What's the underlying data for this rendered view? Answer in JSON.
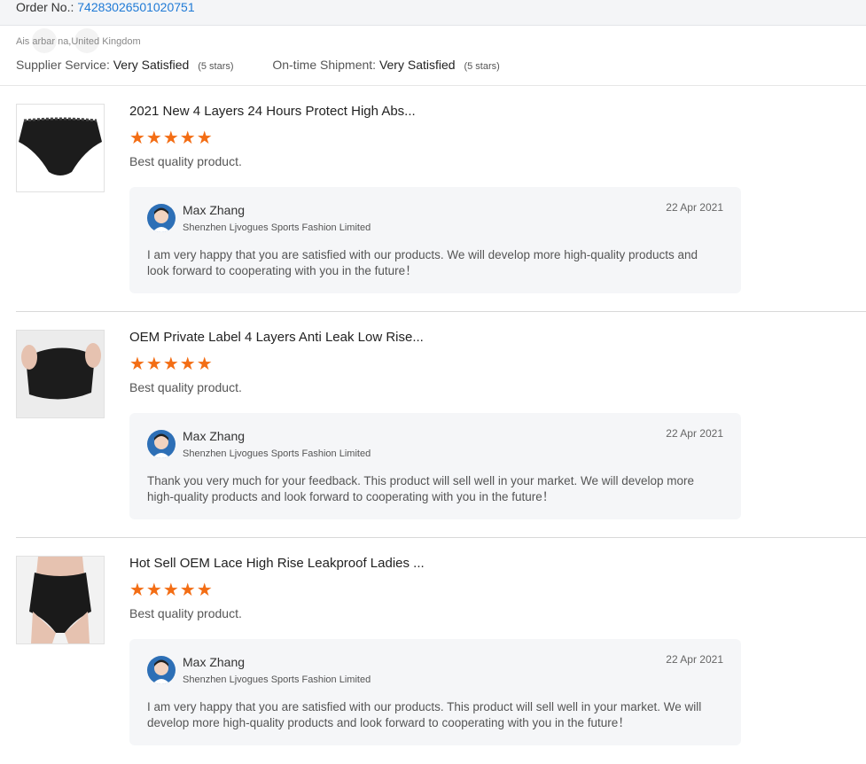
{
  "order": {
    "label": "Order No.:",
    "number": "74283026501020751"
  },
  "buyer": {
    "location": "Ais     arbar    na,United Kingdom"
  },
  "ratings": {
    "supplier_label": "Supplier Service:",
    "supplier_value": "Very Satisfied",
    "supplier_stars": "(5 stars)",
    "shipment_label": "On-time Shipment:",
    "shipment_value": "Very Satisfied",
    "shipment_stars": "(5 stars)"
  },
  "reviews": [
    {
      "title": "2021 New 4 Layers 24 Hours Protect High Abs...",
      "stars": "★★★★★",
      "rating": 5,
      "comment": "Best quality product.",
      "reply": {
        "name": "Max Zhang",
        "company": "Shenzhen Ljvogues Sports Fashion Limited",
        "date": "22 Apr 2021",
        "text": "I am very happy that you are satisfied with our products. We will develop more high-quality products and look forward to cooperating with you in the future！"
      }
    },
    {
      "title": "OEM Private Label 4 Layers Anti Leak Low Rise...",
      "stars": "★★★★★",
      "rating": 5,
      "comment": "Best quality product.",
      "reply": {
        "name": "Max Zhang",
        "company": "Shenzhen Ljvogues Sports Fashion Limited",
        "date": "22 Apr 2021",
        "text": "Thank you very much for your feedback. This product will sell well in your market. We will develop more high-quality products and look forward to cooperating with you in the future！"
      }
    },
    {
      "title": "Hot Sell OEM Lace High Rise Leakproof Ladies ...",
      "stars": "★★★★★",
      "rating": 5,
      "comment": "Best quality product.",
      "reply": {
        "name": "Max Zhang",
        "company": "Shenzhen Ljvogues Sports Fashion Limited",
        "date": "22 Apr 2021",
        "text": "I am very happy that you are satisfied with our products. This product will sell well in your market. We will develop more high-quality products and look forward to cooperating with you in the future！"
      }
    }
  ],
  "colors": {
    "star": "#f36d14",
    "link": "#1f7ad6",
    "reply_bg": "#f5f6f8"
  }
}
